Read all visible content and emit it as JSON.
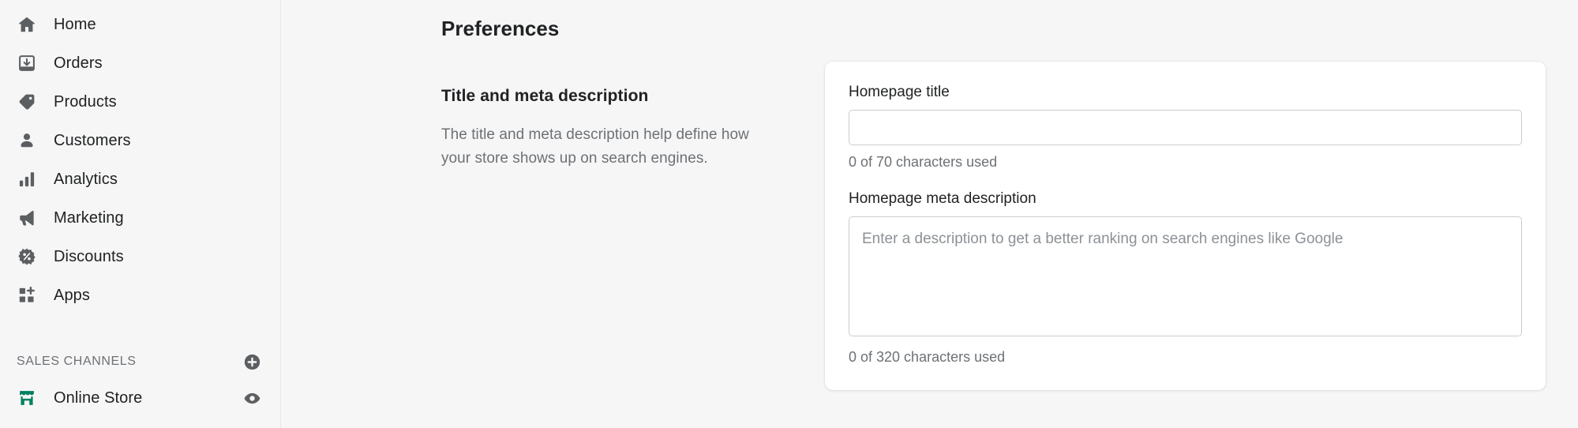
{
  "sidebar": {
    "nav_items": [
      {
        "label": "Home",
        "icon": "home-icon"
      },
      {
        "label": "Orders",
        "icon": "orders-icon"
      },
      {
        "label": "Products",
        "icon": "products-tag-icon"
      },
      {
        "label": "Customers",
        "icon": "customers-person-icon"
      },
      {
        "label": "Analytics",
        "icon": "analytics-bars-icon"
      },
      {
        "label": "Marketing",
        "icon": "marketing-megaphone-icon"
      },
      {
        "label": "Discounts",
        "icon": "discounts-percent-icon"
      },
      {
        "label": "Apps",
        "icon": "apps-grid-plus-icon"
      }
    ],
    "sales_channels": {
      "title": "SALES CHANNELS",
      "add_icon": "circle-plus-icon",
      "items": [
        {
          "label": "Online Store",
          "icon": "online-store-icon",
          "icon_color": "#008060",
          "trailing_icon": "eye-icon"
        }
      ]
    }
  },
  "main": {
    "page_title": "Preferences",
    "section": {
      "heading": "Title and meta description",
      "description": "The title and meta description help define how your store shows up on search engines."
    },
    "form": {
      "homepage_title": {
        "label": "Homepage title",
        "value": "",
        "placeholder": "",
        "helper": "0 of 70 characters used"
      },
      "homepage_meta_description": {
        "label": "Homepage meta description",
        "value": "",
        "placeholder": "Enter a description to get a better ranking on search engines like Google",
        "helper": "0 of 320 characters used"
      }
    }
  },
  "colors": {
    "page_background": "#f6f6f7",
    "card_background": "#ffffff",
    "text_primary": "#202223",
    "text_subdued": "#6d7175",
    "border": "#c9cccf",
    "brand_green": "#008060"
  }
}
